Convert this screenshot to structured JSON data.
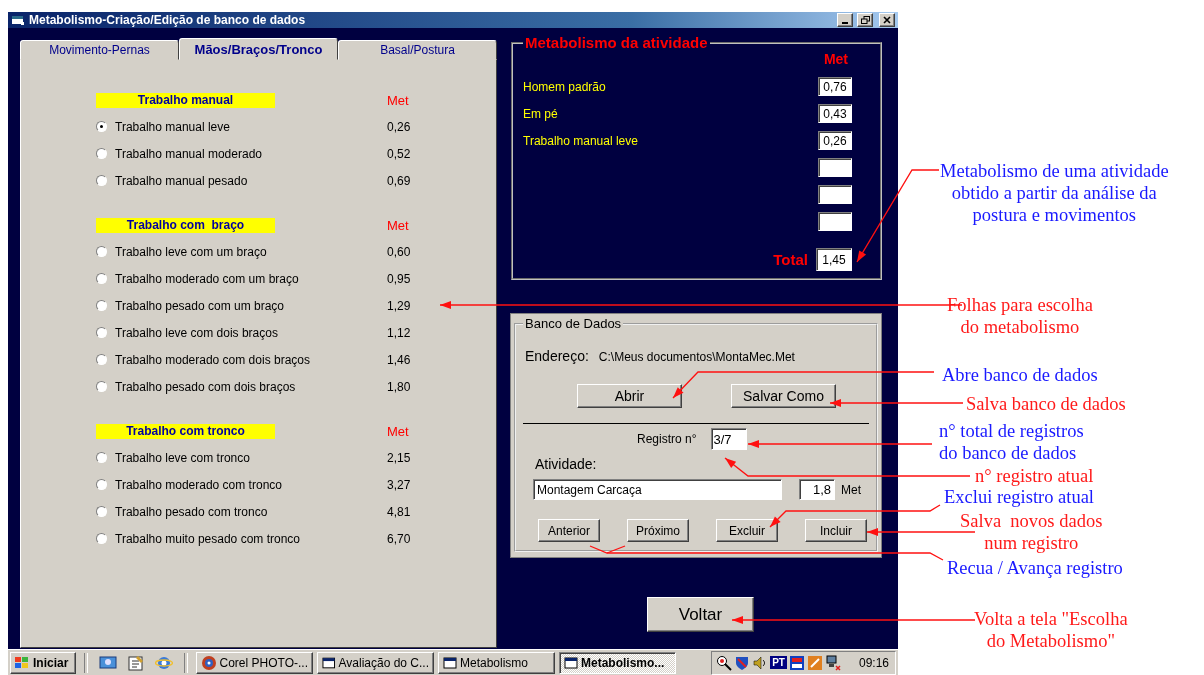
{
  "window": {
    "title": "Metabolismo-Criação/Edição de banco de dados"
  },
  "tabs": [
    {
      "label": "Movimento-Pernas",
      "selected": false
    },
    {
      "label": "Mãos/Braços/Tronco",
      "selected": true
    },
    {
      "label": "Basal/Postura",
      "selected": false
    }
  ],
  "sections": [
    {
      "heading": "Trabalho manual",
      "unit": "Met",
      "options": [
        {
          "label": "Trabalho manual leve",
          "value": "0,26",
          "selected": true
        },
        {
          "label": "Trabalho manual moderado",
          "value": "0,52",
          "selected": false
        },
        {
          "label": "Trabalho manual pesado",
          "value": "0,69",
          "selected": false
        }
      ]
    },
    {
      "heading": "Trabalho com  braço",
      "unit": "Met",
      "options": [
        {
          "label": "Trabalho leve com um braço",
          "value": "0,60",
          "selected": false
        },
        {
          "label": "Trabalho moderado com um braço",
          "value": "0,95",
          "selected": false
        },
        {
          "label": "Trabalho pesado com um braço",
          "value": "1,29",
          "selected": false
        },
        {
          "label": "Trabalho leve com dois braços",
          "value": "1,12",
          "selected": false
        },
        {
          "label": "Trabalho moderado com dois braços",
          "value": "1,46",
          "selected": false
        },
        {
          "label": "Trabalho pesado com dois braços",
          "value": "1,80",
          "selected": false
        }
      ]
    },
    {
      "heading": "Trabalho com tronco",
      "unit": "Met",
      "options": [
        {
          "label": "Trabalho leve com tronco",
          "value": "2,15",
          "selected": false
        },
        {
          "label": "Trabalho moderado com tronco",
          "value": "3,27",
          "selected": false
        },
        {
          "label": "Trabalho pesado com tronco",
          "value": "4,81",
          "selected": false
        },
        {
          "label": "Trabalho muito pesado com tronco",
          "value": "6,70",
          "selected": false
        }
      ]
    }
  ],
  "activity": {
    "title": "Metabolismo da atividade",
    "unit": "Met",
    "rows": [
      {
        "kind": "filled",
        "label": "Homem padrão",
        "value": "0,76"
      },
      {
        "kind": "filled",
        "label": "Em pé",
        "value": "0,43"
      },
      {
        "kind": "filled",
        "label": "Trabalho manual leve",
        "value": "0,26"
      },
      {
        "kind": "empty"
      },
      {
        "kind": "empty"
      },
      {
        "kind": "empty"
      }
    ],
    "total_label": "Total",
    "total_value": "1,45"
  },
  "database": {
    "title": "Banco de Dados",
    "address_label": "Endereço:",
    "address": "C:\\Meus documentos\\MontaMec.Met",
    "file_buttons": [
      "Abrir",
      "Salvar Como"
    ],
    "record_label": "Registro n°",
    "record_value": "3/7",
    "activity_label": "Atividade:",
    "activity_value": "Montagem Carcaça",
    "met_value": "1,8",
    "met_unit": "Met",
    "record_buttons": [
      "Anterior",
      "Próximo",
      "Excluir",
      "Incluir"
    ]
  },
  "back_button": "Voltar",
  "taskbar": {
    "start": "Iniciar",
    "tasks": [
      {
        "kind": "app",
        "label": "Corel PHOTO-...",
        "selected": false
      },
      {
        "kind": "window",
        "label": "Avaliação do C...",
        "selected": false
      },
      {
        "kind": "window",
        "label": "Metabolismo",
        "selected": false
      },
      {
        "kind": "window",
        "label": "Metabolismo...",
        "selected": true
      }
    ],
    "tray_language": "PT",
    "clock": "09:16"
  },
  "callouts": [
    {
      "lines": [
        "Metabolismo de uma atividade",
        "obtido a partir da análise da",
        "postura e movimentos"
      ],
      "color": "#1a1aff"
    },
    {
      "lines": [
        "Folhas para escolha",
        "do metabolismo"
      ],
      "color": "#ff1a1a"
    },
    {
      "lines": [
        "Abre banco de dados"
      ],
      "color": "#1a1aff"
    },
    {
      "lines": [
        "Salva banco de dados"
      ],
      "color": "#ff1a1a"
    },
    {
      "lines": [
        "n° total de registros",
        "do banco de dados"
      ],
      "color": "#1a1aff"
    },
    {
      "lines": [
        "n° registro atual"
      ],
      "color": "#ff1a1a"
    },
    {
      "lines": [
        "Exclui registro atual"
      ],
      "color": "#1a1aff"
    },
    {
      "lines": [
        "Salva  novos dados",
        "num registro"
      ],
      "color": "#ff1a1a"
    },
    {
      "lines": [
        "Recua / Avança registro"
      ],
      "color": "#1a1aff"
    },
    {
      "lines": [
        "Volta a tela \"Escolha",
        "do Metabolismo\""
      ],
      "color": "#ff1a1a"
    }
  ]
}
